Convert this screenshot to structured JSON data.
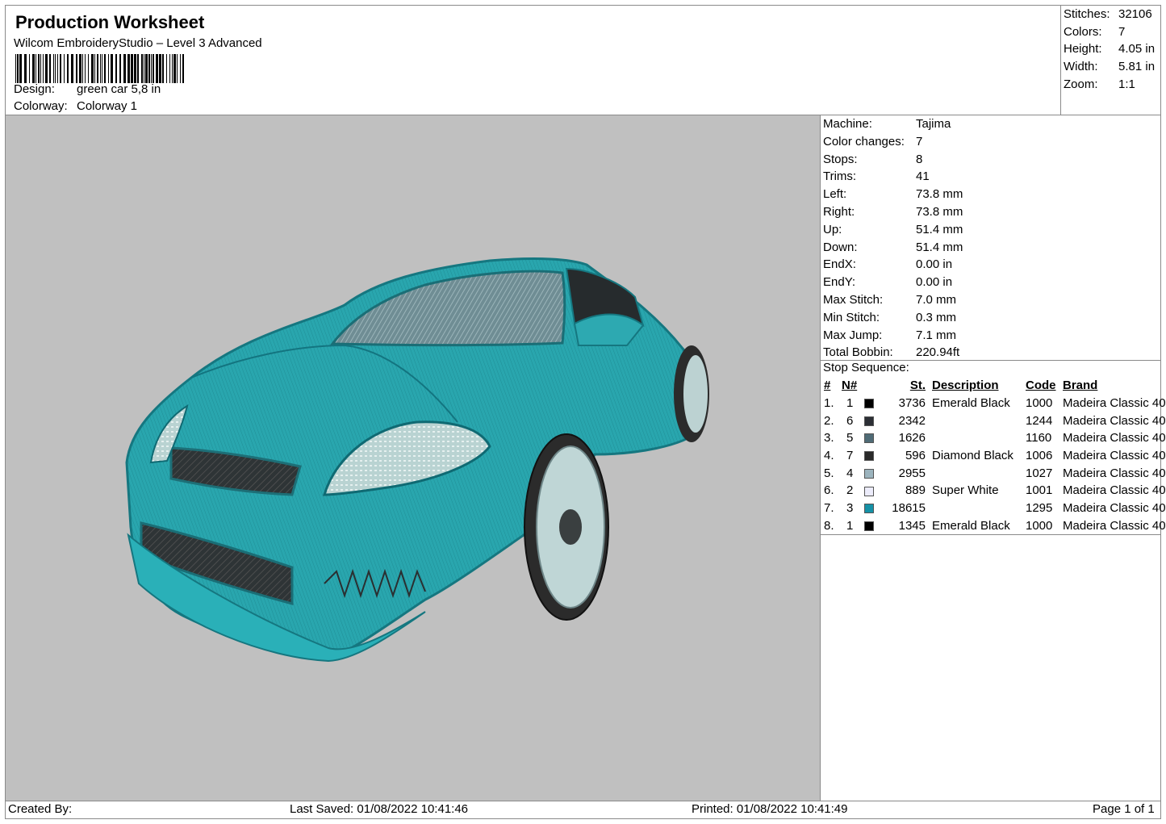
{
  "header": {
    "title": "Production Worksheet",
    "software": "Wilcom EmbroideryStudio – Level 3 Advanced",
    "design_label": "Design:",
    "design_value": "green car 5,8 in",
    "colorway_label": "Colorway:",
    "colorway_value": "Colorway 1"
  },
  "stats": [
    {
      "label": "Stitches:",
      "value": "32106"
    },
    {
      "label": "Colors:",
      "value": "7"
    },
    {
      "label": "Height:",
      "value": "4.05 in"
    },
    {
      "label": "Width:",
      "value": "5.81 in"
    },
    {
      "label": "Zoom:",
      "value": "1:1"
    }
  ],
  "properties": [
    {
      "label": "Machine:",
      "value": "Tajima"
    },
    {
      "label": "Color changes:",
      "value": "7"
    },
    {
      "label": "Stops:",
      "value": "8"
    },
    {
      "label": "Trims:",
      "value": "41"
    },
    {
      "label": "Left:",
      "value": "73.8 mm"
    },
    {
      "label": "Right:",
      "value": "73.8 mm"
    },
    {
      "label": "Up:",
      "value": "51.4 mm"
    },
    {
      "label": "Down:",
      "value": "51.4 mm"
    },
    {
      "label": "EndX:",
      "value": "0.00 in"
    },
    {
      "label": "EndY:",
      "value": "0.00 in"
    },
    {
      "label": "Max Stitch:",
      "value": "7.0 mm"
    },
    {
      "label": "Min Stitch:",
      "value": "0.3 mm"
    },
    {
      "label": "Max Jump:",
      "value": "7.1 mm"
    },
    {
      "label": "Total Bobbin:",
      "value": "220.94ft"
    }
  ],
  "stop_sequence": {
    "title": "Stop Sequence:",
    "headers": [
      "#",
      "N#",
      "St.",
      "Description",
      "Code",
      "Brand"
    ],
    "rows": [
      {
        "idx": "1.",
        "n": "1",
        "color": "#000000",
        "st": "3736",
        "desc": "Emerald Black",
        "code": "1000",
        "brand": "Madeira Classic 40"
      },
      {
        "idx": "2.",
        "n": "6",
        "color": "#2c2f35",
        "st": "2342",
        "desc": "",
        "code": "1244",
        "brand": "Madeira Classic 40"
      },
      {
        "idx": "3.",
        "n": "5",
        "color": "#4f6b76",
        "st": "1626",
        "desc": "",
        "code": "1160",
        "brand": "Madeira Classic 40"
      },
      {
        "idx": "4.",
        "n": "7",
        "color": "#2a2a2a",
        "st": "596",
        "desc": "Diamond Black",
        "code": "1006",
        "brand": "Madeira Classic 40"
      },
      {
        "idx": "5.",
        "n": "4",
        "color": "#9cb4be",
        "st": "2955",
        "desc": "",
        "code": "1027",
        "brand": "Madeira Classic 40"
      },
      {
        "idx": "6.",
        "n": "2",
        "color": "#ececfb",
        "st": "889",
        "desc": "Super White",
        "code": "1001",
        "brand": "Madeira Classic 40"
      },
      {
        "idx": "7.",
        "n": "3",
        "color": "#1591a6",
        "st": "18615",
        "desc": "",
        "code": "1295",
        "brand": "Madeira Classic 40"
      },
      {
        "idx": "8.",
        "n": "1",
        "color": "#000000",
        "st": "1345",
        "desc": "Emerald Black",
        "code": "1000",
        "brand": "Madeira Classic 40"
      }
    ]
  },
  "footer": {
    "created_by": "Created By:",
    "last_saved": "Last Saved: 01/08/2022 10:41:46",
    "printed": "Printed: 01/08/2022 10:41:49",
    "page": "Page 1 of 1"
  },
  "colors": {
    "canvas_bg": "#c0c0c0",
    "car_body": "#29a6ae"
  }
}
